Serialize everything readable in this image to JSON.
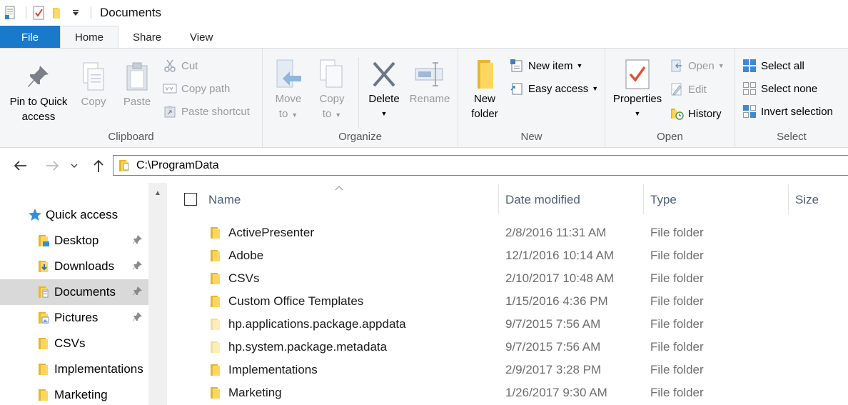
{
  "window": {
    "title": "Documents"
  },
  "tabs": [
    {
      "label": "File"
    },
    {
      "label": "Home"
    },
    {
      "label": "Share"
    },
    {
      "label": "View"
    }
  ],
  "ribbon": {
    "clipboard": {
      "label": "Clipboard",
      "pin_line1": "Pin to Quick",
      "pin_line2": "access",
      "copy": "Copy",
      "paste": "Paste",
      "cut": "Cut",
      "copy_path": "Copy path",
      "paste_shortcut": "Paste shortcut"
    },
    "organize": {
      "label": "Organize",
      "move_line1": "Move",
      "move_line2": "to",
      "copy_line1": "Copy",
      "copy_line2": "to",
      "delete": "Delete",
      "rename": "Rename"
    },
    "new": {
      "label": "New",
      "folder_line1": "New",
      "folder_line2": "folder",
      "new_item": "New item",
      "easy_access": "Easy access"
    },
    "open": {
      "label": "Open",
      "properties": "Properties",
      "open": "Open",
      "edit": "Edit",
      "history": "History"
    },
    "select": {
      "label": "Select",
      "select_all": "Select all",
      "select_none": "Select none",
      "invert": "Invert selection"
    }
  },
  "address": {
    "path": "C:\\ProgramData"
  },
  "nav_pane": {
    "quick_access": "Quick access",
    "items": [
      {
        "label": "Desktop",
        "pinned": true
      },
      {
        "label": "Downloads",
        "pinned": true
      },
      {
        "label": "Documents",
        "pinned": true,
        "selected": true
      },
      {
        "label": "Pictures",
        "pinned": true
      },
      {
        "label": "CSVs",
        "pinned": false
      },
      {
        "label": "Implementations",
        "pinned": false
      },
      {
        "label": "Marketing",
        "pinned": false
      }
    ]
  },
  "columns": {
    "name": "Name",
    "date": "Date modified",
    "type": "Type",
    "size": "Size"
  },
  "files": [
    {
      "name": "ActivePresenter",
      "date": "2/8/2016 11:31 AM",
      "type": "File folder"
    },
    {
      "name": "Adobe",
      "date": "12/1/2016 10:14 AM",
      "type": "File folder"
    },
    {
      "name": "CSVs",
      "date": "2/10/2017 10:48 AM",
      "type": "File folder"
    },
    {
      "name": "Custom Office Templates",
      "date": "1/15/2016 4:36 PM",
      "type": "File folder"
    },
    {
      "name": "hp.applications.package.appdata",
      "date": "9/7/2015 7:56 AM",
      "type": "File folder"
    },
    {
      "name": "hp.system.package.metadata",
      "date": "9/7/2015 7:56 AM",
      "type": "File folder"
    },
    {
      "name": "Implementations",
      "date": "2/9/2017 3:28 PM",
      "type": "File folder"
    },
    {
      "name": "Marketing",
      "date": "1/26/2017 9:30 AM",
      "type": "File folder"
    }
  ]
}
